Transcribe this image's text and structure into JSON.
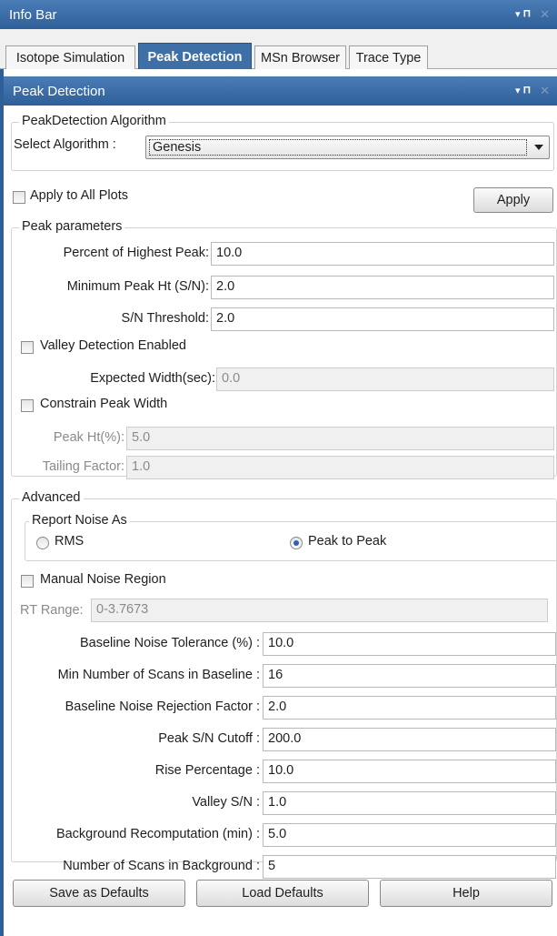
{
  "window": {
    "title": "Info Bar",
    "pin_glyph": "▾ ф",
    "close_glyph": "×"
  },
  "tabs": [
    {
      "label": "Isotope Simulation",
      "active": false
    },
    {
      "label": "Peak Detection",
      "active": true
    },
    {
      "label": "MSn Browser",
      "active": false
    },
    {
      "label": "Trace Type",
      "active": false
    }
  ],
  "panel": {
    "title": "Peak Detection"
  },
  "algorithm": {
    "group_title": "PeakDetection Algorithm",
    "select_label": "Select Algorithm :",
    "selected": "Genesis"
  },
  "apply_all": {
    "label": "Apply to All Plots",
    "checked": false
  },
  "apply_button": "Apply",
  "peak_params": {
    "group_title": "Peak parameters",
    "percent_highest_label": "Percent of Highest Peak:",
    "percent_highest_value": "10.0",
    "min_peak_ht_label": "Minimum Peak Ht (S/N):",
    "min_peak_ht_value": "2.0",
    "sn_threshold_label": "S/N Threshold:",
    "sn_threshold_value": "2.0",
    "valley_label": "Valley Detection Enabled",
    "valley_checked": false,
    "expected_width_label": "Expected Width(sec):",
    "expected_width_value": "0.0",
    "constrain_label": "Constrain Peak Width",
    "constrain_checked": false,
    "peak_ht_pct_label": "Peak Ht(%):",
    "peak_ht_pct_value": "5.0",
    "tailing_label": "Tailing Factor:",
    "tailing_value": "1.0"
  },
  "advanced": {
    "group_title": "Advanced",
    "report_noise_title": "Report Noise As",
    "rms_label": "RMS",
    "p2p_label": "Peak to Peak",
    "selected_noise": "Peak to Peak",
    "manual_noise_label": "Manual Noise Region",
    "manual_noise_checked": false,
    "rt_range_label": "RT Range:",
    "rt_range_value": "0-3.7673",
    "fields": [
      {
        "label": "Baseline Noise Tolerance (%) :",
        "value": "10.0"
      },
      {
        "label": "Min Number of Scans in Baseline :",
        "value": "16"
      },
      {
        "label": "Baseline Noise Rejection Factor :",
        "value": "2.0"
      },
      {
        "label": "Peak S/N Cutoff :",
        "value": "200.0"
      },
      {
        "label": "Rise Percentage :",
        "value": "10.0"
      },
      {
        "label": "Valley S/N :",
        "value": "1.0"
      },
      {
        "label": "Background Recomputation (min) :",
        "value": "5.0"
      },
      {
        "label": "Number of Scans in Background :",
        "value": "5"
      }
    ]
  },
  "buttons": {
    "save_defaults": "Save as Defaults",
    "load_defaults": "Load Defaults",
    "help": "Help"
  }
}
